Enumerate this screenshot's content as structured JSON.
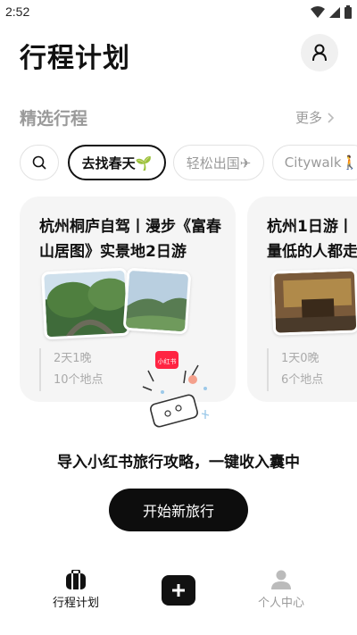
{
  "status_bar": {
    "time": "2:52"
  },
  "header": {
    "title": "行程计划"
  },
  "section": {
    "title": "精选行程",
    "more_label": "更多"
  },
  "chips": [
    {
      "label": "去找春天🌱",
      "active": true
    },
    {
      "label": "轻松出国✈",
      "active": false
    },
    {
      "label": "Citywalk🚶",
      "active": false
    }
  ],
  "cards": [
    {
      "title": "杭州桐庐自驾丨漫步《富春山居图》实景地2日游",
      "duration": "2天1晚",
      "places": "10个地点"
    },
    {
      "title": "杭州1日游丨量低的人都走",
      "title_line1": "杭州1日游丨",
      "title_line2": "量低的人都走",
      "duration": "1天0晚",
      "places": "6个地点"
    }
  ],
  "import": {
    "badge": "小红书",
    "text": "导入小红书旅行攻略，一键收入囊中"
  },
  "start_button": {
    "label": "开始新旅行"
  },
  "tabbar": {
    "trips_label": "行程计划",
    "profile_label": "个人中心"
  },
  "colors": {
    "primary": "#111111",
    "muted": "#9a9a9a",
    "card_bg": "#f5f5f5",
    "badge_red": "#ff2442"
  }
}
